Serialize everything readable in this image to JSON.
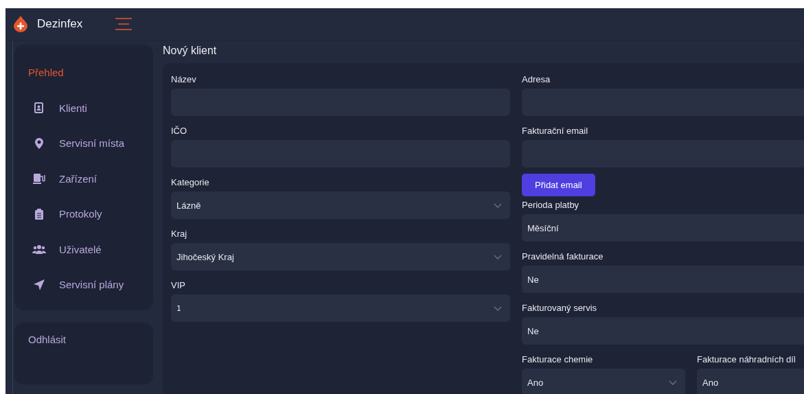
{
  "app": {
    "name": "Dezinfex"
  },
  "sidebar": {
    "items": [
      {
        "label": "Přehled",
        "selected": true
      },
      {
        "label": "Klienti",
        "selected": false
      },
      {
        "label": "Servisní místa",
        "selected": false
      },
      {
        "label": "Zařízení",
        "selected": false
      },
      {
        "label": "Protokoly",
        "selected": false
      },
      {
        "label": "Uživatelé",
        "selected": false
      },
      {
        "label": "Servisní plány",
        "selected": false
      }
    ],
    "logout": "Odhlásit"
  },
  "page": {
    "title": "Nový klient"
  },
  "form": {
    "left": [
      {
        "label": "Název",
        "kind": "input"
      },
      {
        "label": "IČO",
        "kind": "input"
      },
      {
        "label": "Kategorie",
        "kind": "select",
        "value": "Lázně"
      },
      {
        "label": "Kraj",
        "kind": "select",
        "value": "Jihočeský Kraj"
      },
      {
        "label": "VIP",
        "kind": "select",
        "value": "1"
      }
    ],
    "right": [
      {
        "label": "Adresa",
        "kind": "input"
      },
      {
        "label": "Fakturační email",
        "kind": "input"
      },
      {
        "label": "Přidat email",
        "kind": "button"
      },
      {
        "label": "Perioda platby",
        "kind": "value",
        "value": "Měsíční"
      },
      {
        "label": "Pravidelná fakturace",
        "kind": "value",
        "value": "Ne"
      },
      {
        "label": "Fakturovaný servis",
        "kind": "value",
        "value": "Ne"
      }
    ],
    "pair": [
      {
        "label": "Fakturace chemie",
        "kind": "select",
        "value": "Ano"
      },
      {
        "label": "Fakturace náhradních díl",
        "kind": "value",
        "value": "Ano"
      }
    ]
  }
}
